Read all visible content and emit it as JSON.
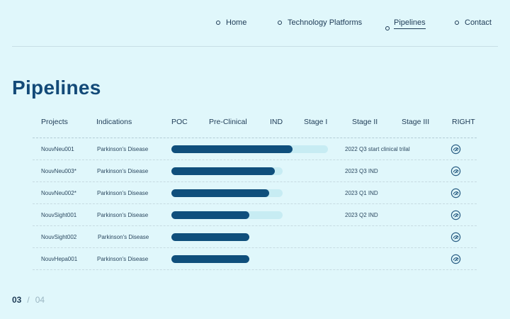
{
  "nav": {
    "items": [
      {
        "label": "Home",
        "active": false
      },
      {
        "label": "Technology Platforms",
        "active": false
      },
      {
        "label": "Pipelines",
        "active": true
      },
      {
        "label": "Contact",
        "active": false
      }
    ]
  },
  "page_title": "Pipelines",
  "table": {
    "columns": [
      "Projects",
      "Indications",
      "POC",
      "Pre-Clinical",
      "IND",
      "Stage I",
      "Stage II",
      "Stage III",
      "RIGHT"
    ],
    "stage_max": 5,
    "rows": [
      {
        "project": "NouvNeu001",
        "indication": "Parkinson's Disease",
        "progress": 3.1,
        "track_to": 4.0,
        "status": "2022 Q3 start clinical trilal"
      },
      {
        "project": "NouvNeu003*",
        "indication": "Parkinson's Disease",
        "progress": 2.65,
        "track_to": 2.85,
        "status": "2023 Q3 IND"
      },
      {
        "project": "NouvNeu002*",
        "indication": "Parkinson's Disease",
        "progress": 2.5,
        "track_to": 2.85,
        "status": "2023 Q1 IND"
      },
      {
        "project": "NouvSight001",
        "indication": "Parkinson's Disease",
        "progress": 2.0,
        "track_to": 2.85,
        "status": "2023 Q2 IND"
      },
      {
        "project": "NouvSight002",
        "indication": "Parkinson's Disease",
        "progress": 2.0,
        "track_to": 2.0,
        "status": ""
      },
      {
        "project": "NouvHepa001",
        "indication": "Parkinson's Disease",
        "progress": 2.0,
        "track_to": 2.0,
        "status": ""
      }
    ]
  },
  "pager": {
    "current": "03",
    "separator": "/",
    "total": "04"
  },
  "colors": {
    "background": "#e0f7fb",
    "bar_fill": "#0f4f7c",
    "bar_track": "#c7ecf3",
    "title": "#134a78"
  }
}
